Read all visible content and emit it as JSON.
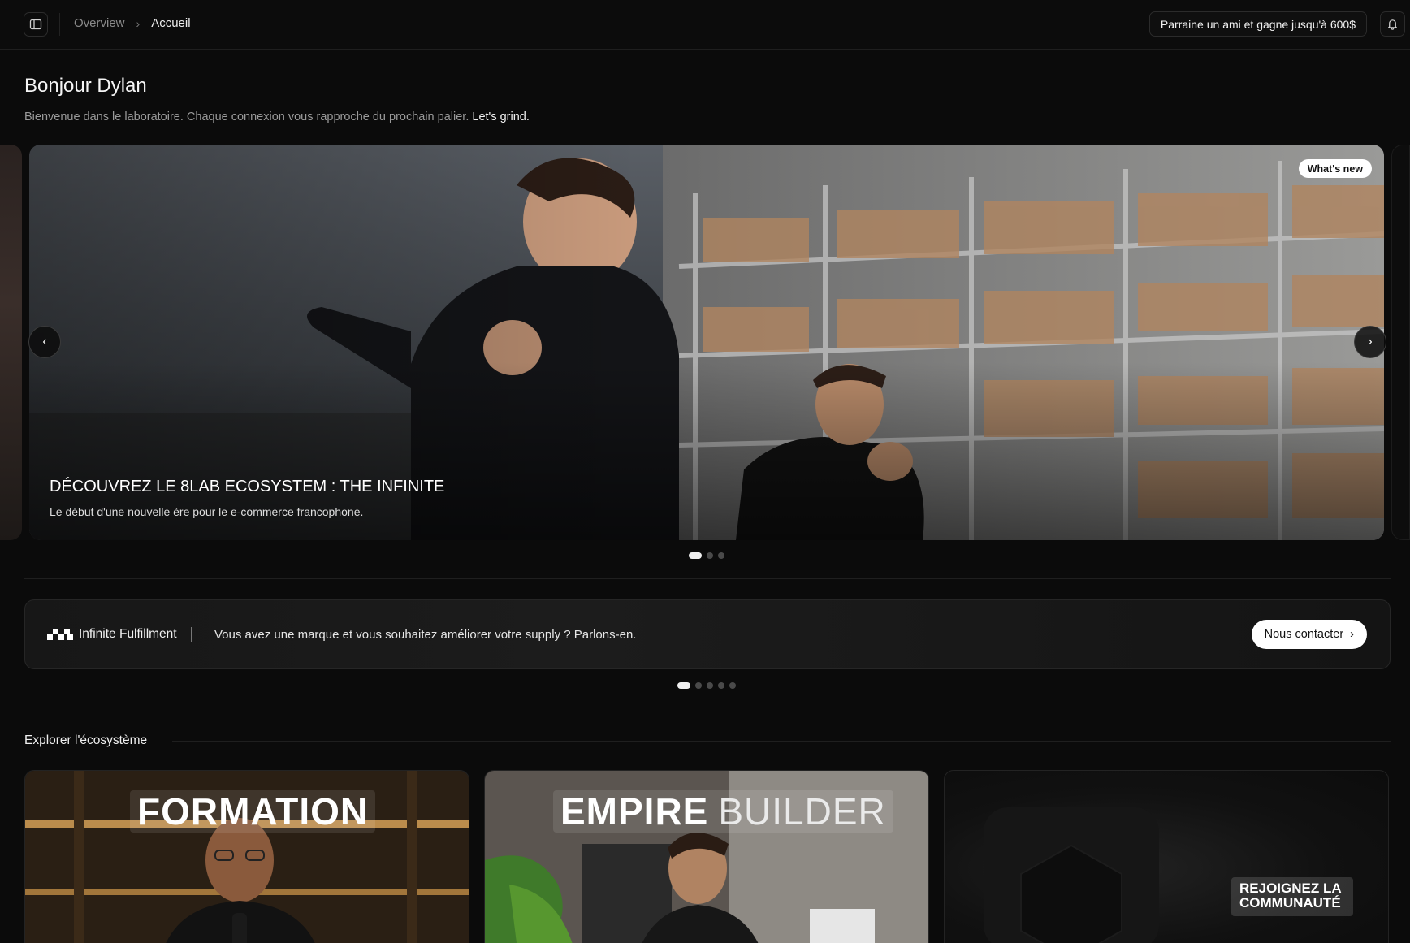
{
  "topbar": {
    "breadcrumb": {
      "parent": "Overview",
      "separator": "›",
      "current": "Accueil"
    },
    "referral_label": "Parraine un ami et gagne jusqu'à 600$",
    "icons": {
      "sidebar": "sidebar-toggle-icon",
      "bell": "bell-icon"
    }
  },
  "greeting": {
    "title": "Bonjour Dylan",
    "welcome_text": "Bienvenue dans le laboratoire. Chaque connexion vous rapproche du prochain palier.",
    "welcome_highlight": "Let's grind."
  },
  "hero": {
    "badge": "What's new",
    "title": "DÉCOUVREZ LE 8LAB ECOSYSTEM : THE INFINITE",
    "subtitle": "Le début d'une nouvelle ère pour le e-commerce francophone.",
    "prev_icon": "‹",
    "next_icon": "›",
    "slides_count": 3,
    "active_slide": 0
  },
  "banner": {
    "brand": "Infinite Fulfillment",
    "text": "Vous avez une marque et vous souhaitez améliorer votre supply ? Parlons-en.",
    "button_label": "Nous contacter",
    "button_icon": "›",
    "slides_count": 5,
    "active_slide": 0
  },
  "explore": {
    "label": "Explorer l'écosystème",
    "cards": [
      {
        "title": "FORMATION"
      },
      {
        "title_bold": "EMPIRE",
        "title_light": "BUILDER"
      },
      {
        "badge_line1": "REJOIGNEZ LA",
        "badge_line2": "COMMUNAUTÉ"
      }
    ]
  },
  "colors": {
    "background": "#0b0b0b",
    "surface": "#171717",
    "text_primary": "#f5f5f5",
    "text_muted": "#9a9a9a",
    "button_light": "#ffffff"
  }
}
